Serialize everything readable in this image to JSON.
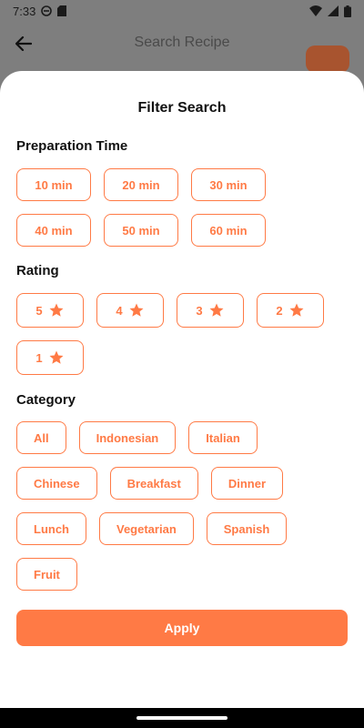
{
  "status_bar": {
    "time": "7:33"
  },
  "appbar": {
    "title": "Search Recipe"
  },
  "sheet": {
    "title": "Filter Search",
    "preparation": {
      "label": "Preparation Time",
      "options": [
        "10 min",
        "20 min",
        "30 min",
        "40 min",
        "50 min",
        "60 min"
      ]
    },
    "rating": {
      "label": "Rating",
      "options": [
        "5",
        "4",
        "3",
        "2",
        "1"
      ]
    },
    "category": {
      "label": "Category",
      "options": [
        "All",
        "Indonesian",
        "Italian",
        "Chinese",
        "Breakfast",
        "Dinner",
        "Lunch",
        "Vegetarian",
        "Spanish",
        "Fruit"
      ]
    },
    "apply_label": "Apply"
  },
  "colors": {
    "accent": "#ff7a45",
    "scrim": "#7e7e7e"
  }
}
